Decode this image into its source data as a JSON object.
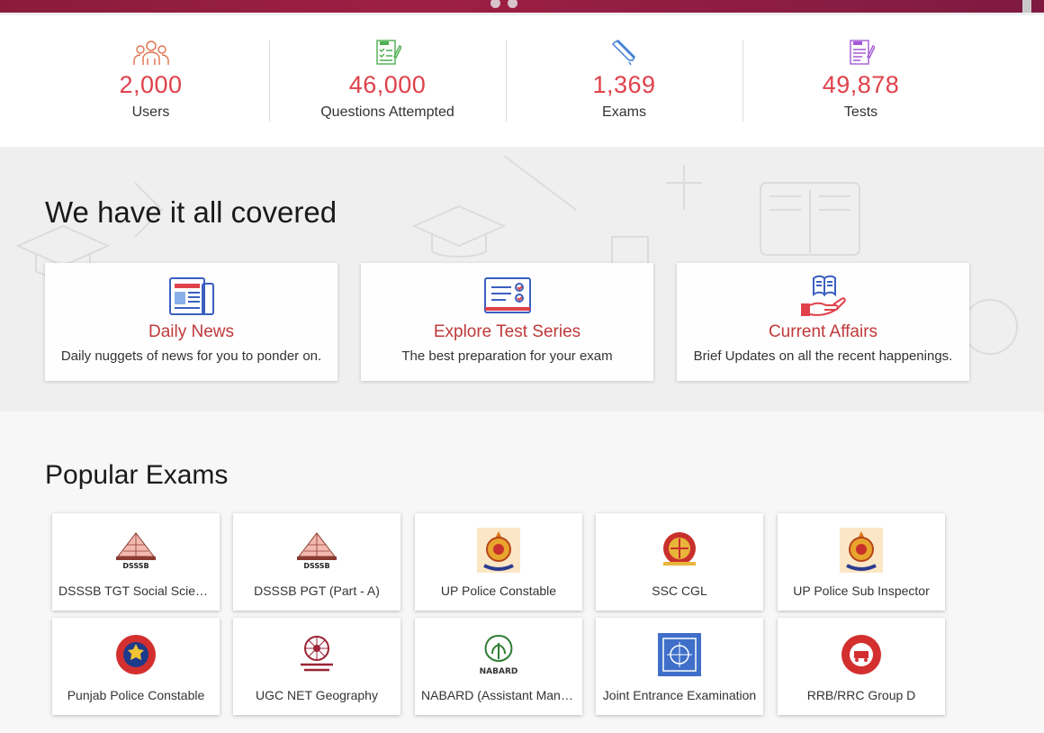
{
  "stats": [
    {
      "icon": "users-icon",
      "value": "2,000",
      "label": "Users"
    },
    {
      "icon": "test-checklist-icon",
      "value": "46,000",
      "label": "Questions Attempted"
    },
    {
      "icon": "pen-icon",
      "value": "1,369",
      "label": "Exams"
    },
    {
      "icon": "test-sheet-icon",
      "value": "49,878",
      "label": "Tests"
    }
  ],
  "covered": {
    "heading": "We have it all covered",
    "cards": [
      {
        "icon": "newspaper-icon",
        "title": "Daily News",
        "desc": "Daily nuggets of news for you to ponder on."
      },
      {
        "icon": "test-series-icon",
        "title": "Explore Test Series",
        "desc": "The best preparation for your exam"
      },
      {
        "icon": "hand-book-icon",
        "title": "Current Affairs",
        "desc": "Brief Updates on all the recent happenings."
      }
    ]
  },
  "popular": {
    "heading": "Popular Exams",
    "exams": [
      {
        "logo": "dsssb-logo-icon",
        "name": "DSSSB TGT Social Science"
      },
      {
        "logo": "dsssb-logo-icon",
        "name": "DSSSB PGT (Part - A)"
      },
      {
        "logo": "up-police-emblem-icon",
        "name": "UP Police Constable"
      },
      {
        "logo": "ssc-emblem-icon",
        "name": "SSC CGL"
      },
      {
        "logo": "up-police-emblem-icon",
        "name": "UP Police Sub Inspector"
      },
      {
        "logo": "punjab-police-emblem-icon",
        "name": "Punjab Police Constable"
      },
      {
        "logo": "ugc-emblem-icon",
        "name": "UGC NET Geography"
      },
      {
        "logo": "nabard-logo-icon",
        "name": "NABARD (Assistant Manager)"
      },
      {
        "logo": "jee-emblem-icon",
        "name": "Joint Entrance Examination"
      },
      {
        "logo": "indian-railways-emblem-icon",
        "name": "RRB/RRC Group D"
      }
    ],
    "nabard_text": "NABARD",
    "dsssb_text": "DSSSB"
  },
  "colors": {
    "accent": "#e0414b",
    "card_title": "#c0393a",
    "banner": "#9e1f45"
  }
}
